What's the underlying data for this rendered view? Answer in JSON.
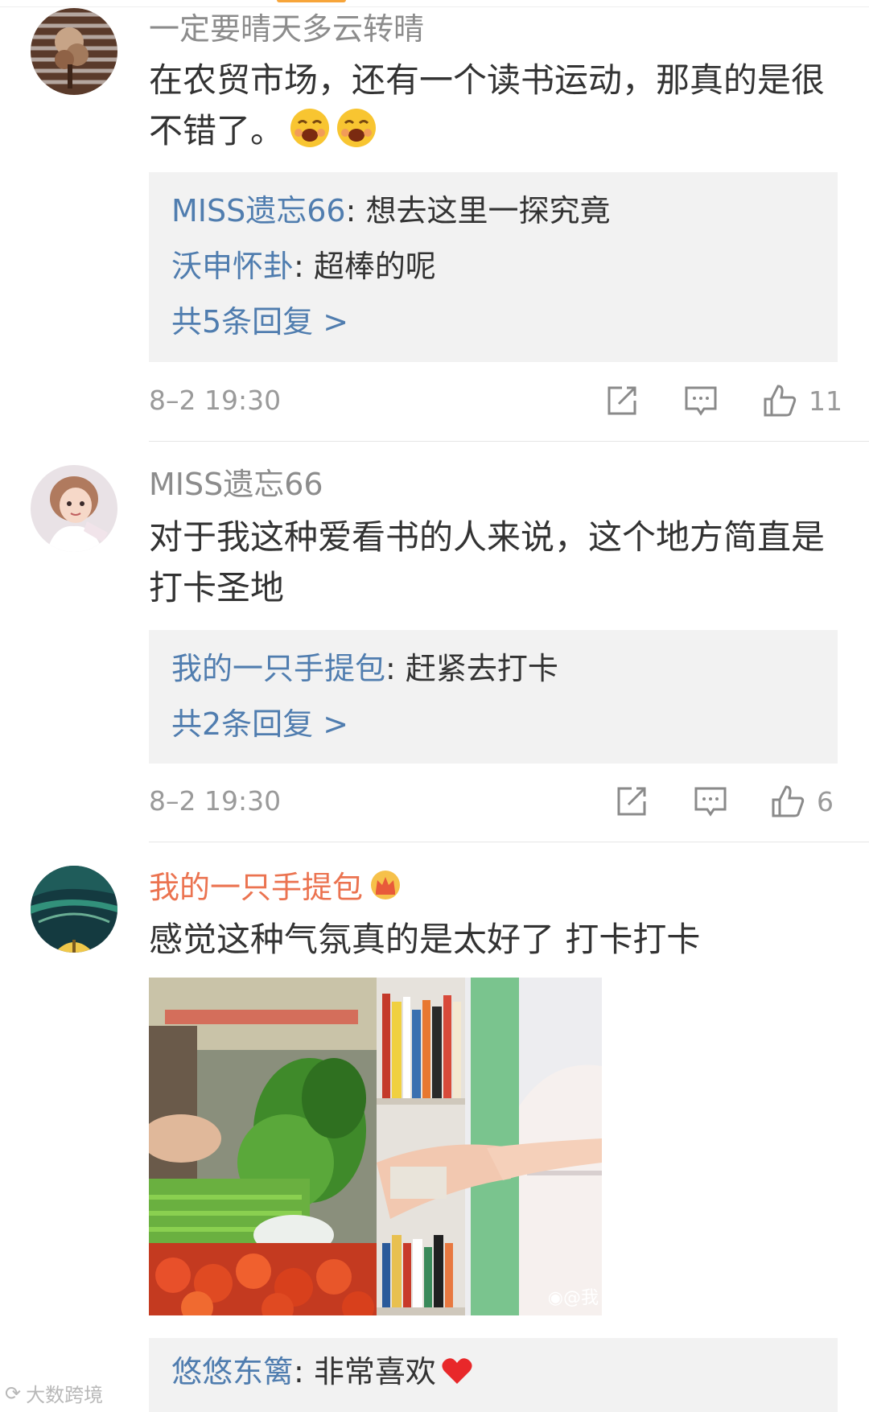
{
  "comments": [
    {
      "user": "一定要晴天多云转晴",
      "text": "在农贸市场，还有一个读书运动，那真的是很不错了。",
      "emoji": "laughing-face-emoji",
      "replies": [
        {
          "name": "MISS遗忘66",
          "sep": ":",
          "text": " 想去这里一探究竟"
        },
        {
          "name": "沃申怀卦",
          "sep": ":",
          "text": " 超棒的呢"
        }
      ],
      "more": "共5条回复 >",
      "time": "8–2 19:30",
      "likes": "11"
    },
    {
      "user": "MISS遗忘66",
      "text": "对于我这种爱看书的人来说，这个地方简直是打卡圣地",
      "replies": [
        {
          "name": "我的一只手提包",
          "sep": ":",
          "text": " 赶紧去打卡"
        }
      ],
      "more": "共2条回复 >",
      "time": "8–2 19:30",
      "likes": "6"
    },
    {
      "user": "我的一只手提包",
      "badge": "crown-icon",
      "text": "感觉这种气氛真的是太好了  打卡打卡",
      "image_watermark": "@我",
      "replies": [
        {
          "name": "悠悠东篱",
          "sep": ":",
          "text": " 非常喜欢"
        }
      ]
    }
  ],
  "watermark": "大数跨境",
  "icons": {
    "share": "share-icon",
    "comment": "comment-icon",
    "like": "thumbs-up-icon"
  },
  "colors": {
    "username": "#8c8c8c",
    "vip_username": "#eb7350",
    "reply_link": "#507daf",
    "reply_bg": "#f2f2f2",
    "accent_tab": "#f7a53a"
  }
}
